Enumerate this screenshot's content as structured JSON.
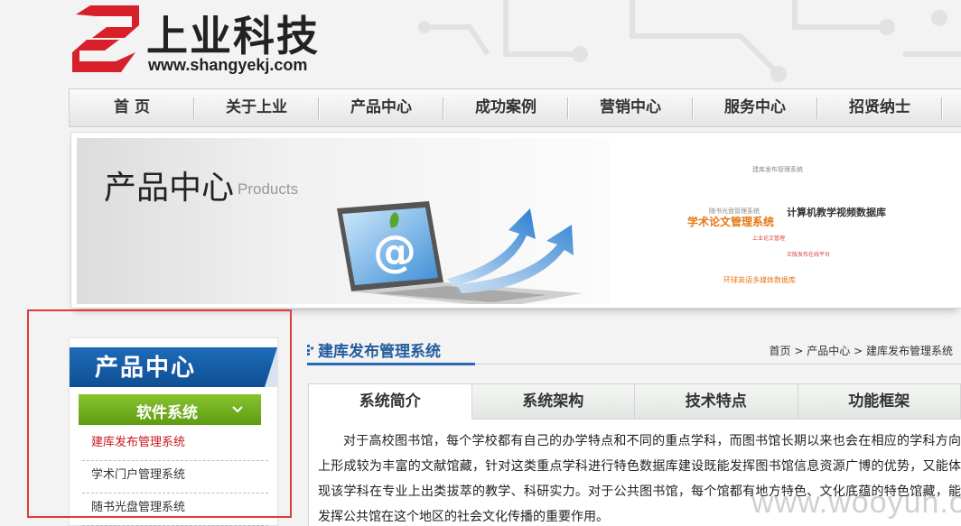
{
  "logo": {
    "name": "上业科技",
    "url": "www.shangyekj.com"
  },
  "nav": {
    "items": [
      "首 页",
      "关于上业",
      "产品中心",
      "成功案例",
      "营销中心",
      "服务中心",
      "招贤纳士"
    ]
  },
  "banner": {
    "title": "产品中心",
    "subtitle": "Products",
    "cloud": {
      "w1": "建库发布管理系统",
      "w2": "随书光盘管理系统",
      "w3": "学术论文管理系统",
      "w4": "计算机教学视频数据库",
      "w5": "上业论文管理",
      "w6": "正版发布在线平台",
      "w7": "环球英语多媒体数据库"
    }
  },
  "sidebar": {
    "title": "产品中心",
    "category": "软件系统",
    "items": [
      {
        "label": "建库发布管理系统"
      },
      {
        "label": "学术门户管理系统"
      },
      {
        "label": "随书光盘管理系统"
      }
    ]
  },
  "main": {
    "title": "建库发布管理系统",
    "breadcrumb": {
      "home": "首页",
      "sep": ">",
      "level1": "产品中心",
      "current": "建库发布管理系统"
    },
    "tabs": [
      "系统简介",
      "系统架构",
      "技术特点",
      "功能框架"
    ],
    "article": "对于高校图书馆，每个学校都有自己的办学特点和不同的重点学科，而图书馆长期以来也会在相应的学科方向上形成较为丰富的文献馆藏，针对这类重点学科进行特色数据库建设既能发挥图书馆信息资源广博的优势，又能体现该学科在专业上出类拔萃的教学、科研实力。对于公共图书馆，每个馆都有地方特色、文化底蕴的特色馆藏，能发挥公共馆在这个地区的社会文化传播的重要作用。"
  },
  "watermark": "www.wooyun.org",
  "colors": {
    "brand_red": "#d8202a",
    "sidebar_blue": "#1661ad",
    "category_green": "#6fae1c",
    "active_link": "#c9151e",
    "highlight_box": "#e03a3a",
    "cloud_orange": "#e67817"
  }
}
